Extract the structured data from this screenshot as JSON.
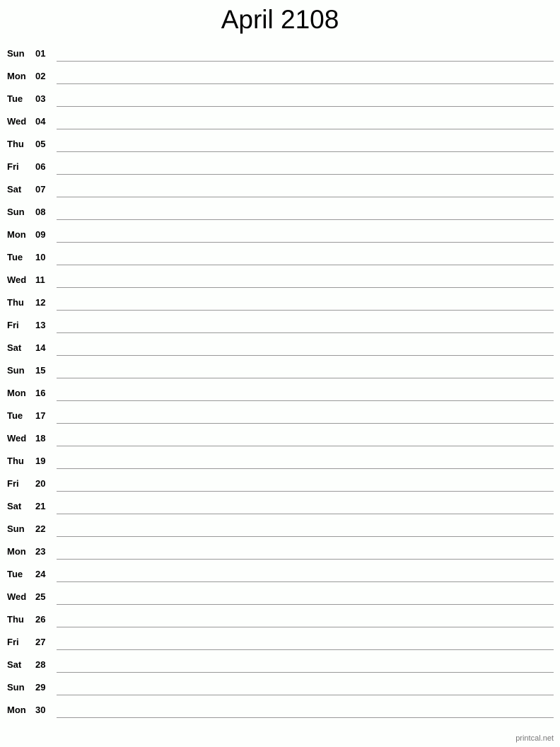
{
  "title": "April 2108",
  "days": [
    {
      "dow": "Sun",
      "day": "01"
    },
    {
      "dow": "Mon",
      "day": "02"
    },
    {
      "dow": "Tue",
      "day": "03"
    },
    {
      "dow": "Wed",
      "day": "04"
    },
    {
      "dow": "Thu",
      "day": "05"
    },
    {
      "dow": "Fri",
      "day": "06"
    },
    {
      "dow": "Sat",
      "day": "07"
    },
    {
      "dow": "Sun",
      "day": "08"
    },
    {
      "dow": "Mon",
      "day": "09"
    },
    {
      "dow": "Tue",
      "day": "10"
    },
    {
      "dow": "Wed",
      "day": "11"
    },
    {
      "dow": "Thu",
      "day": "12"
    },
    {
      "dow": "Fri",
      "day": "13"
    },
    {
      "dow": "Sat",
      "day": "14"
    },
    {
      "dow": "Sun",
      "day": "15"
    },
    {
      "dow": "Mon",
      "day": "16"
    },
    {
      "dow": "Tue",
      "day": "17"
    },
    {
      "dow": "Wed",
      "day": "18"
    },
    {
      "dow": "Thu",
      "day": "19"
    },
    {
      "dow": "Fri",
      "day": "20"
    },
    {
      "dow": "Sat",
      "day": "21"
    },
    {
      "dow": "Sun",
      "day": "22"
    },
    {
      "dow": "Mon",
      "day": "23"
    },
    {
      "dow": "Tue",
      "day": "24"
    },
    {
      "dow": "Wed",
      "day": "25"
    },
    {
      "dow": "Thu",
      "day": "26"
    },
    {
      "dow": "Fri",
      "day": "27"
    },
    {
      "dow": "Sat",
      "day": "28"
    },
    {
      "dow": "Sun",
      "day": "29"
    },
    {
      "dow": "Mon",
      "day": "30"
    }
  ],
  "footer": "printcal.net"
}
